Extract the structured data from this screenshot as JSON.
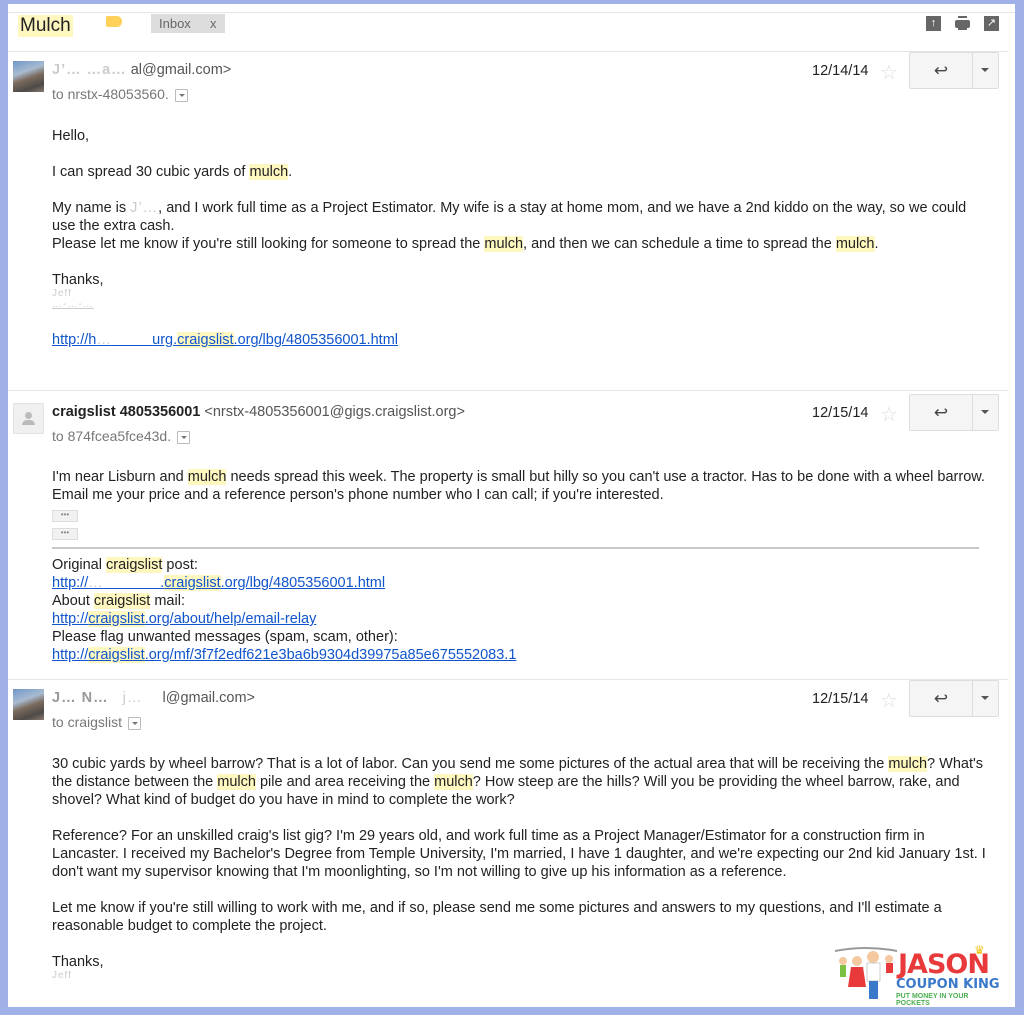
{
  "header": {
    "subject": "Mulch",
    "label_chip": "Inbox",
    "label_chip_close": "x",
    "icons": [
      "archive-icon",
      "print-icon",
      "new-window-icon"
    ]
  },
  "messages": [
    {
      "sender_name_redacted": "J’…  …a…",
      "sender_email_visible": "al@gmail.com>",
      "to": "to nrstx-48053560.",
      "date": "12/14/14",
      "avatar": "photo",
      "body": {
        "greeting": "Hello,",
        "line1_pre": "I can spread 30 cubic yards of ",
        "line1_hl": "mulch",
        "line1_post": ".",
        "para2_a": "My name is ",
        "para2_redacted": "J’…",
        "para2_b": ", and I work full time as a Project Estimator.  My wife is a stay at home mom, and we have a 2nd kiddo on the way, so we could use the extra cash.",
        "para3_a": "Please let me know if you're still looking for someone to spread the ",
        "para3_hl1": "mulch",
        "para3_b": ", and then we can schedule a time to spread the ",
        "para3_hl2": "mulch",
        "para3_c": ".",
        "signoff": "Thanks,",
        "sig_redacted": "Jeff",
        "phone_redacted": "…-…-…",
        "link_pre": "http://h",
        "link_redacted": "…",
        "link_mid": "urg.",
        "link_hl": "craigslist",
        "link_post": ".org/lbg/4805356001.html"
      }
    },
    {
      "sender_name": "craigslist 4805356001",
      "sender_email": "<nrstx-4805356001@gigs.craigslist.org>",
      "to": "to 874fcea5fce43d.",
      "date": "12/15/14",
      "avatar": "generic",
      "body": {
        "p1_a": "I'm near Lisburn and ",
        "p1_hl": "mulch",
        "p1_b": " needs spread this week.  The property is small but hilly so you can't use a tractor.  Has to be done with a wheel barrow.   Email me your price and a reference person's phone number who I can call; if you're interested.",
        "ellipsis": "•••",
        "footer": [
          {
            "pre": "Original ",
            "hl": "craigslist",
            "post": " post:"
          },
          {
            "link_pre": "http://",
            "link_redacted": "…",
            "link_hl": "craigslist",
            "link_post": ".org/lbg/4805356001.html"
          },
          {
            "pre": "About ",
            "hl": "craigslist",
            "post": " mail:"
          },
          {
            "link_pre": "http://",
            "link_hl": "craigslist",
            "link_post": ".org/about/help/email-relay"
          },
          {
            "text": "Please flag unwanted messages (spam, scam, other):"
          },
          {
            "link_pre": "http://",
            "link_hl": "craigslist",
            "link_post": ".org/mf/3f7f2edf621e3ba6b9304d39975a85e675552083.1"
          }
        ]
      }
    },
    {
      "sender_name_redacted": "J… N…",
      "sender_email_visible": "l@gmail.com>",
      "to": "to craigslist",
      "date": "12/15/14",
      "avatar": "photo",
      "body": {
        "p1_a": "30 cubic yards by wheel barrow?  That is a lot of labor.  Can you send me some pictures of the actual area that will be receiving the ",
        "p1_hl1": "mulch",
        "p1_b": "?  What's the distance between the ",
        "p1_hl2": "mulch",
        "p1_c": " pile and area receiving the ",
        "p1_hl3": "mulch",
        "p1_d": "?  How steep are the hills?  Will you be providing the wheel barrow, rake, and shovel?  What kind of budget do you have in mind to complete the work?",
        "p2": "Reference?  For an unskilled craig's list gig?  I'm 29 years old, and work full time as a Project Manager/Estimator for a construction firm in Lancaster.  I received my Bachelor's Degree from Temple University, I'm married, I have 1 daughter, and we're expecting our 2nd kid January 1st.   I don't want my supervisor knowing that I'm moonlighting, so I'm not willing to give up his information as a reference.",
        "p3": "Let me know if you're still willing to work with me, and if so, please send me some pictures and answers to my questions, and I'll estimate a reasonable budget to complete the project.",
        "signoff": "Thanks,",
        "sig_redacted": "Jeff"
      }
    }
  ],
  "watermark": {
    "line1": "JASON",
    "line2": "COUPON KING",
    "tagline": "PUT MONEY IN YOUR POCKETS"
  }
}
